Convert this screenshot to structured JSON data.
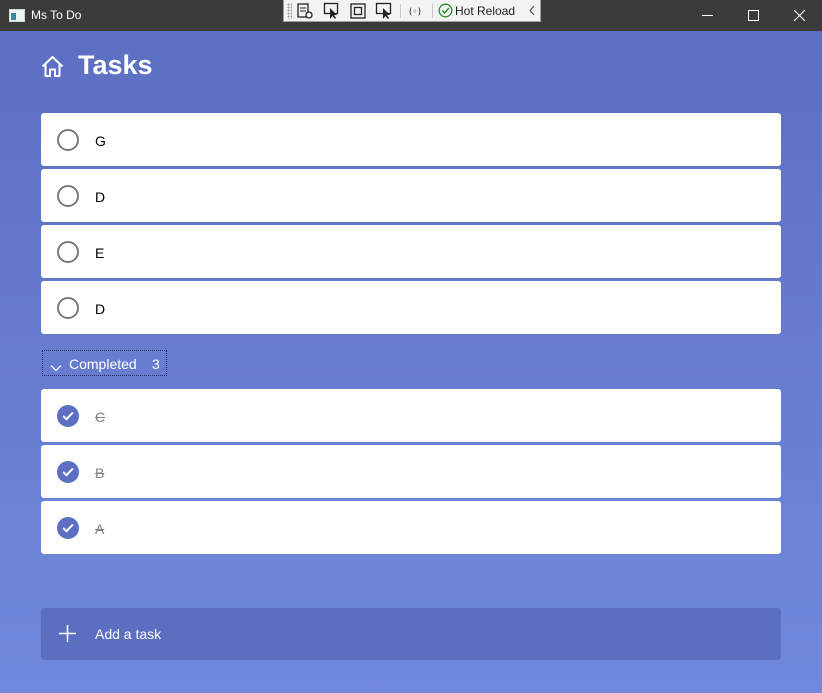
{
  "window": {
    "title": "Ms To Do"
  },
  "devbar": {
    "hot_reload_label": "Hot Reload"
  },
  "page": {
    "title": "Tasks",
    "icon": "home-icon"
  },
  "active_tasks": [
    {
      "label": "G",
      "completed": false
    },
    {
      "label": "D",
      "completed": false
    },
    {
      "label": "E",
      "completed": false
    },
    {
      "label": "D",
      "completed": false
    }
  ],
  "completed_section": {
    "label": "Completed",
    "count": "3",
    "expanded": true
  },
  "completed_tasks": [
    {
      "label": "C",
      "completed": true
    },
    {
      "label": "B",
      "completed": true
    },
    {
      "label": "A",
      "completed": true
    }
  ],
  "add_task": {
    "label": "Add a task"
  },
  "colors": {
    "accent": "#5c6fc2",
    "background_top": "#5c6fc2",
    "background_bottom": "#7189dc",
    "titlebar": "#3b3b3b",
    "completed_text": "#808080"
  }
}
